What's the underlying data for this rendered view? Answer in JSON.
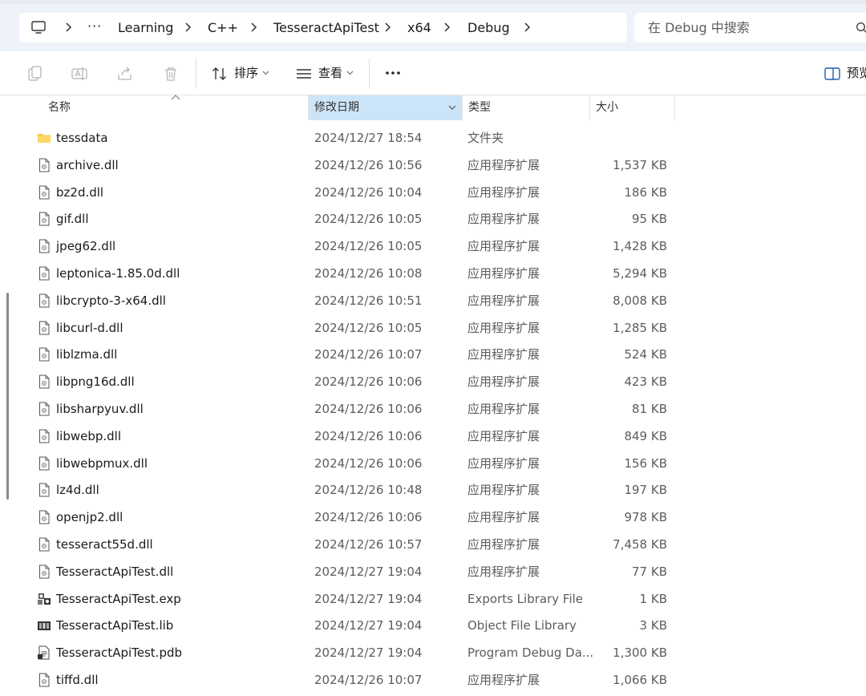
{
  "address": {
    "segments": [
      "Learning",
      "C++",
      "TesseractApiTest",
      "x64",
      "Debug"
    ],
    "overflow_label": "···"
  },
  "search": {
    "placeholder": "在 Debug 中搜索"
  },
  "toolbar": {
    "sort_label": "排序",
    "view_label": "查看",
    "more_label": "···",
    "preview_label": "预览"
  },
  "columns": {
    "name": "名称",
    "date": "修改日期",
    "type": "类型",
    "size": "大小"
  },
  "files": [
    {
      "name": "tessdata",
      "date": "2024/12/27 18:54",
      "type": "文件夹",
      "size": "",
      "icon": "folder-icon"
    },
    {
      "name": "archive.dll",
      "date": "2024/12/26 10:56",
      "type": "应用程序扩展",
      "size": "1,537 KB",
      "icon": "dll-file-icon"
    },
    {
      "name": "bz2d.dll",
      "date": "2024/12/26 10:04",
      "type": "应用程序扩展",
      "size": "186 KB",
      "icon": "dll-file-icon"
    },
    {
      "name": "gif.dll",
      "date": "2024/12/26 10:05",
      "type": "应用程序扩展",
      "size": "95 KB",
      "icon": "dll-file-icon"
    },
    {
      "name": "jpeg62.dll",
      "date": "2024/12/26 10:05",
      "type": "应用程序扩展",
      "size": "1,428 KB",
      "icon": "dll-file-icon"
    },
    {
      "name": "leptonica-1.85.0d.dll",
      "date": "2024/12/26 10:08",
      "type": "应用程序扩展",
      "size": "5,294 KB",
      "icon": "dll-file-icon"
    },
    {
      "name": "libcrypto-3-x64.dll",
      "date": "2024/12/26 10:51",
      "type": "应用程序扩展",
      "size": "8,008 KB",
      "icon": "dll-file-icon"
    },
    {
      "name": "libcurl-d.dll",
      "date": "2024/12/26 10:05",
      "type": "应用程序扩展",
      "size": "1,285 KB",
      "icon": "dll-file-icon"
    },
    {
      "name": "liblzma.dll",
      "date": "2024/12/26 10:07",
      "type": "应用程序扩展",
      "size": "524 KB",
      "icon": "dll-file-icon"
    },
    {
      "name": "libpng16d.dll",
      "date": "2024/12/26 10:06",
      "type": "应用程序扩展",
      "size": "423 KB",
      "icon": "dll-file-icon"
    },
    {
      "name": "libsharpyuv.dll",
      "date": "2024/12/26 10:06",
      "type": "应用程序扩展",
      "size": "81 KB",
      "icon": "dll-file-icon"
    },
    {
      "name": "libwebp.dll",
      "date": "2024/12/26 10:06",
      "type": "应用程序扩展",
      "size": "849 KB",
      "icon": "dll-file-icon"
    },
    {
      "name": "libwebpmux.dll",
      "date": "2024/12/26 10:06",
      "type": "应用程序扩展",
      "size": "156 KB",
      "icon": "dll-file-icon"
    },
    {
      "name": "lz4d.dll",
      "date": "2024/12/26 10:48",
      "type": "应用程序扩展",
      "size": "197 KB",
      "icon": "dll-file-icon"
    },
    {
      "name": "openjp2.dll",
      "date": "2024/12/26 10:06",
      "type": "应用程序扩展",
      "size": "978 KB",
      "icon": "dll-file-icon"
    },
    {
      "name": "tesseract55d.dll",
      "date": "2024/12/26 10:57",
      "type": "应用程序扩展",
      "size": "7,458 KB",
      "icon": "dll-file-icon"
    },
    {
      "name": "TesseractApiTest.dll",
      "date": "2024/12/27 19:04",
      "type": "应用程序扩展",
      "size": "77 KB",
      "icon": "dll-file-icon"
    },
    {
      "name": "TesseractApiTest.exp",
      "date": "2024/12/27 19:04",
      "type": "Exports Library File",
      "size": "1 KB",
      "icon": "exp-file-icon"
    },
    {
      "name": "TesseractApiTest.lib",
      "date": "2024/12/27 19:04",
      "type": "Object File Library",
      "size": "3 KB",
      "icon": "lib-file-icon"
    },
    {
      "name": "TesseractApiTest.pdb",
      "date": "2024/12/27 19:04",
      "type": "Program Debug Da...",
      "size": "1,300 KB",
      "icon": "pdb-file-icon"
    },
    {
      "name": "tiffd.dll",
      "date": "2024/12/26 10:07",
      "type": "应用程序扩展",
      "size": "1,066 KB",
      "icon": "dll-file-icon"
    }
  ]
}
